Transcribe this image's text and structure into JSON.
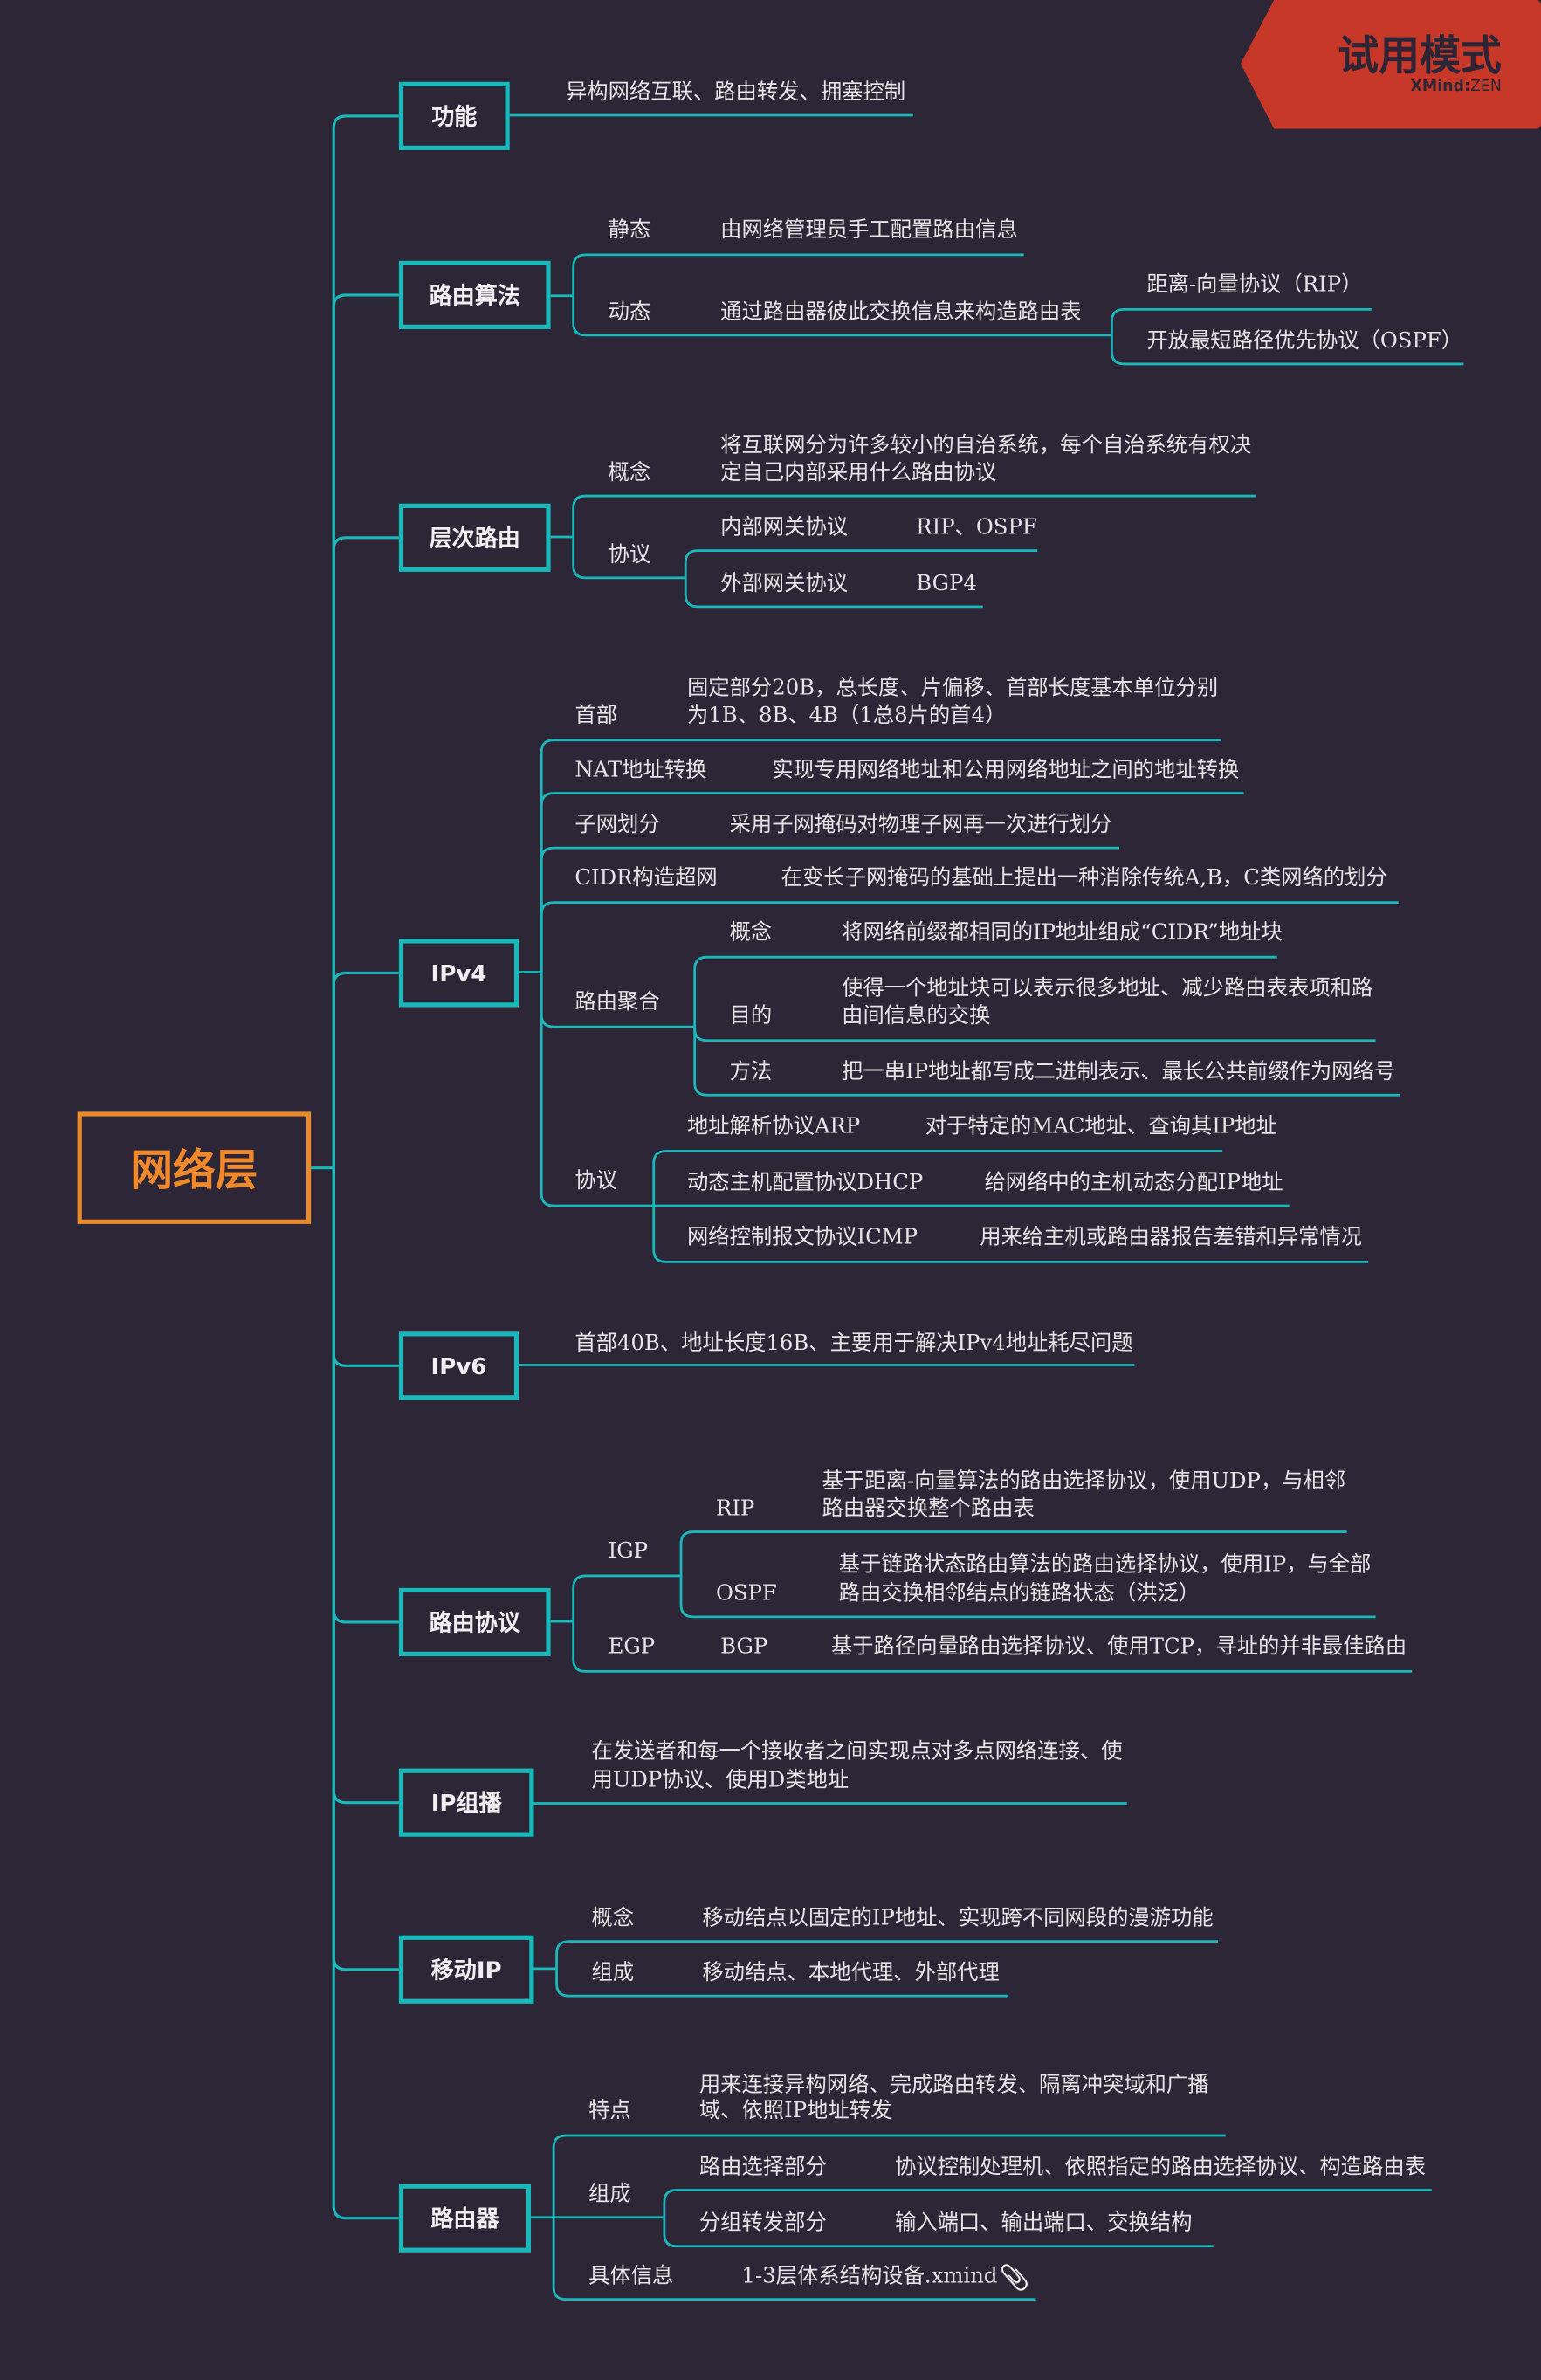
{
  "root": "网络层",
  "watermark": {
    "title": "试用模式",
    "brand": "XMind",
    "separator": ":",
    "edition": "ZEN"
  },
  "colors": {
    "background": "#2d2636",
    "branch": "#19b8bb",
    "root": "#e8892b",
    "watermark": "#c83828",
    "text": "#e6e4e6"
  },
  "topics": [
    {
      "label": "功能",
      "summary": "异构网络互联、路由转发、拥塞控制"
    },
    {
      "label": "路由算法",
      "children": [
        {
          "label": "静态",
          "value": "由网络管理员手工配置路由信息"
        },
        {
          "label": "动态",
          "value": "通过路由器彼此交换信息来构造路由表",
          "children": [
            {
              "label": "距离-向量协议（RIP）"
            },
            {
              "label": "开放最短路径优先协议（OSPF）"
            }
          ]
        }
      ]
    },
    {
      "label": "层次路由",
      "children": [
        {
          "label": "概念",
          "lines": [
            "将互联网分为许多较小的自治系统，每个自治系统有权决",
            "定自己内部采用什么路由协议"
          ]
        },
        {
          "label": "协议",
          "children": [
            {
              "label": "内部网关协议",
              "value": "RIP、OSPF"
            },
            {
              "label": "外部网关协议",
              "value": "BGP4"
            }
          ]
        }
      ]
    },
    {
      "label": "IPv4",
      "children": [
        {
          "label": "首部",
          "lines": [
            "固定部分20B，总长度、片偏移、首部长度基本单位分别",
            "为1B、8B、4B（1总8片的首4）"
          ]
        },
        {
          "label": "NAT地址转换",
          "value": "实现专用网络地址和公用网络地址之间的地址转换"
        },
        {
          "label": "子网划分",
          "value": "采用子网掩码对物理子网再一次进行划分"
        },
        {
          "label": "CIDR构造超网",
          "value": "在变长子网掩码的基础上提出一种消除传统A,B，C类网络的划分"
        },
        {
          "label": "路由聚合",
          "children": [
            {
              "label": "概念",
              "value": "将网络前缀都相同的IP地址组成“CIDR”地址块"
            },
            {
              "label": "目的",
              "lines": [
                "使得一个地址块可以表示很多地址、减少路由表表项和路",
                "由间信息的交换"
              ]
            },
            {
              "label": "方法",
              "value": "把一串IP地址都写成二进制表示、最长公共前缀作为网络号"
            }
          ]
        },
        {
          "label": "协议",
          "children": [
            {
              "label": "地址解析协议ARP",
              "value": "对于特定的MAC地址、查询其IP地址"
            },
            {
              "label": "动态主机配置协议DHCP",
              "value": "给网络中的主机动态分配IP地址"
            },
            {
              "label": "网络控制报文协议ICMP",
              "value": "用来给主机或路由器报告差错和异常情况"
            }
          ]
        }
      ]
    },
    {
      "label": "IPv6",
      "summary": "首部40B、地址长度16B、主要用于解决IPv4地址耗尽问题"
    },
    {
      "label": "路由协议",
      "children": [
        {
          "label": "IGP",
          "children": [
            {
              "label": "RIP",
              "lines": [
                "基于距离-向量算法的路由选择协议，使用UDP，与相邻",
                "路由器交换整个路由表"
              ]
            },
            {
              "label": "OSPF",
              "lines": [
                "基于链路状态路由算法的路由选择协议，使用IP，与全部",
                "路由交换相邻结点的链路状态（洪泛）"
              ]
            }
          ]
        },
        {
          "label": "EGP",
          "children": [
            {
              "label": "BGP",
              "value": "基于路径向量路由选择协议、使用TCP，寻址的并非最佳路由"
            }
          ]
        }
      ]
    },
    {
      "label": "IP组播",
      "lines": [
        "在发送者和每一个接收者之间实现点对多点网络连接、使",
        "用UDP协议、使用D类地址"
      ]
    },
    {
      "label": "移动IP",
      "children": [
        {
          "label": "概念",
          "value": "移动结点以固定的IP地址、实现跨不同网段的漫游功能"
        },
        {
          "label": "组成",
          "value": "移动结点、本地代理、外部代理"
        }
      ]
    },
    {
      "label": "路由器",
      "children": [
        {
          "label": "特点",
          "lines": [
            "用来连接异构网络、完成路由转发、隔离冲突域和广播",
            "域、依照IP地址转发"
          ]
        },
        {
          "label": "组成",
          "children": [
            {
              "label": "路由选择部分",
              "value": "协议控制处理机、依照指定的路由选择协议、构造路由表"
            },
            {
              "label": "分组转发部分",
              "value": "输入端口、输出端口、交换结构"
            }
          ]
        },
        {
          "label": "具体信息",
          "attachment": "1-3层体系结构设备.xmind",
          "attachment_icon": "paperclip-icon"
        }
      ]
    }
  ]
}
